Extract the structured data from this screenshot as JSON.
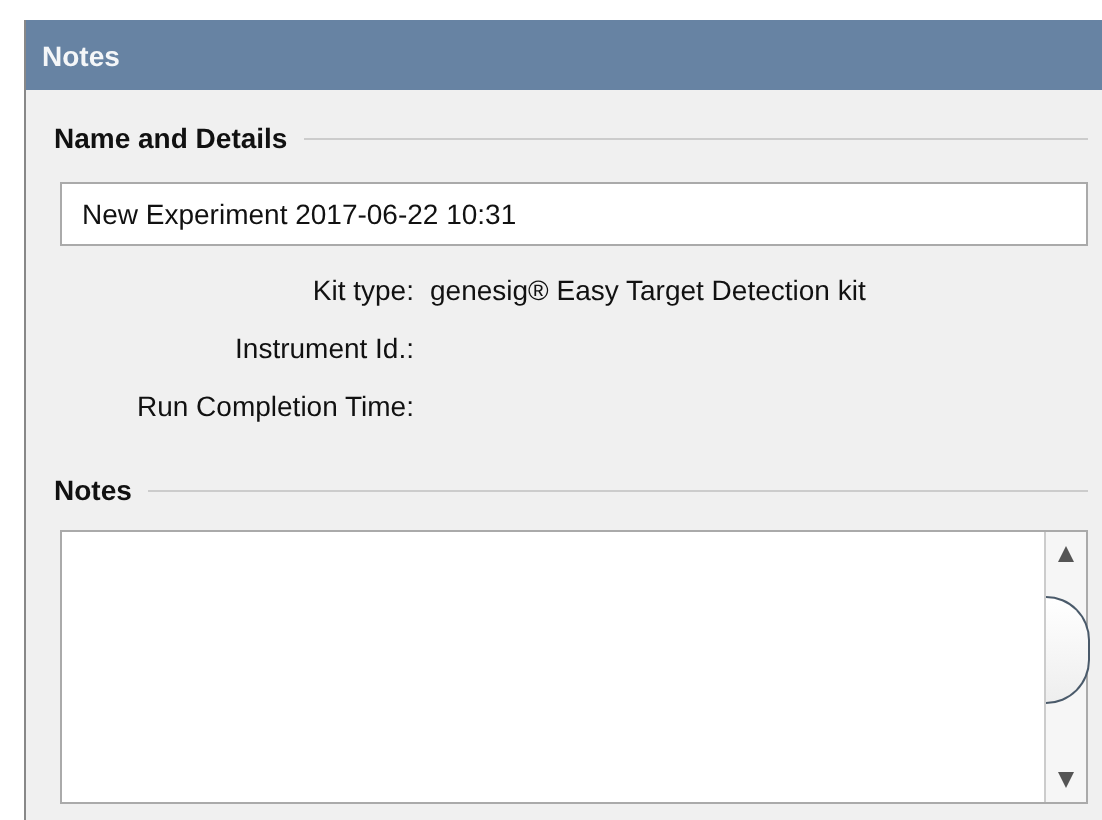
{
  "panel": {
    "title": "Notes"
  },
  "name_and_details": {
    "heading": "Name and Details",
    "name_field": {
      "value": "New Experiment 2017-06-22 10:31"
    },
    "fields": [
      {
        "label": "Kit type:",
        "value": "genesig® Easy Target Detection kit"
      },
      {
        "label": "Instrument Id.:"
      },
      {
        "label": "Run Completion Time:"
      }
    ]
  },
  "notes": {
    "heading": "Notes"
  }
}
